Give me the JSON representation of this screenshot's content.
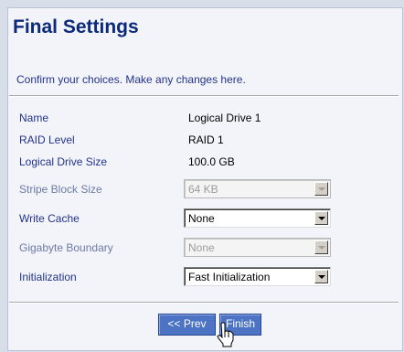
{
  "header": {
    "title": "Final Settings",
    "subtitle": "Confirm your choices. Make any changes here."
  },
  "fields": {
    "name": {
      "label": "Name",
      "value": "Logical Drive 1"
    },
    "raid_level": {
      "label": "RAID Level",
      "value": "RAID 1"
    },
    "size": {
      "label": "Logical Drive Size",
      "value": "100.0 GB"
    },
    "stripe": {
      "label": "Stripe Block Size",
      "value": "64 KB",
      "enabled": false
    },
    "write_cache": {
      "label": "Write Cache",
      "value": "None",
      "enabled": true
    },
    "gigabyte_boundary": {
      "label": "Gigabyte Boundary",
      "value": "None",
      "enabled": false
    },
    "initialization": {
      "label": "Initialization",
      "value": "Fast Initialization",
      "enabled": true
    }
  },
  "buttons": {
    "prev": "<< Prev",
    "finish": "Finish"
  },
  "icons": {
    "cursor": "hand-pointer-icon",
    "dropdown": "chevron-down-icon"
  },
  "colors": {
    "title": "#0b2a7a",
    "label": "#23328b",
    "button": "#4d74c4",
    "panel": "#f2f4fa"
  }
}
